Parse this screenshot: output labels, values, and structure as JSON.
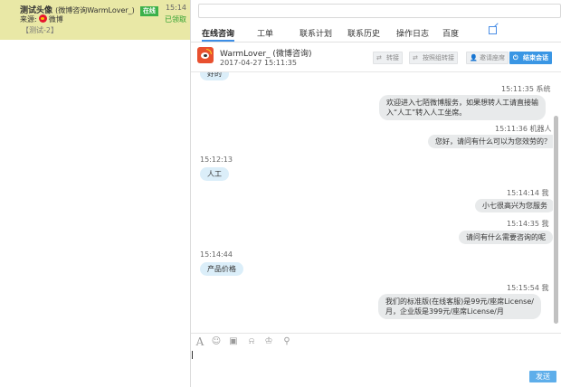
{
  "session": {
    "title": "测试头像",
    "nickname": "(微博咨询WarmLover_)",
    "status": "在线",
    "time": "15:14",
    "source_label": "来源:",
    "source_name": "微博",
    "claimed": "已领取",
    "tag": "【测试-2】"
  },
  "tabs": [
    "在线咨询",
    "工单",
    "联系计划",
    "联系历史",
    "操作日志",
    "百度"
  ],
  "visitor": {
    "name": "WarmLover_ (微博咨询)",
    "time": "2017-04-27 15:11:35"
  },
  "actions": {
    "transfer": "转接",
    "transfer_group": "按照组转接",
    "invite": "邀请座席",
    "end": "结束会话"
  },
  "messages": [
    {
      "role": "visitor",
      "text": "好的"
    },
    {
      "role": "system",
      "time": "15:11:35",
      "sender": "系统",
      "text_lines": [
        "欢迎进入七陌微博服务，如果想转人工请直接输",
        "入“人工”转入人工坐席。"
      ]
    },
    {
      "role": "robot",
      "time": "15:11:36",
      "sender": "机器人",
      "text_lines": [
        "您好，请问有什么可以为您效劳的？"
      ]
    },
    {
      "role": "visitor",
      "time": "15:12:13",
      "text": "人工"
    },
    {
      "role": "agent",
      "time": "15:14:14",
      "sender": "我",
      "text_lines": [
        "小七很高兴为您服务"
      ]
    },
    {
      "role": "agent",
      "time": "15:14:35",
      "sender": "我",
      "text_lines": [
        "请问有什么需要咨询的呢"
      ]
    },
    {
      "role": "visitor",
      "time": "15:14:44",
      "text": "产品价格"
    },
    {
      "role": "agent",
      "time": "15:15:54",
      "sender": "我",
      "text_lines": [
        "我们的标准版(在线客服)是99元/座席License/",
        "月，企业版是399元/座席License/月"
      ]
    }
  ],
  "toolbar_icons": [
    "font-icon",
    "emoji-icon",
    "image-icon",
    "bell-icon",
    "bot-icon",
    "user-search-icon"
  ],
  "send_label": "发送",
  "colors": {
    "session_bg": "#e9e8a6",
    "accent": "#3a96e4",
    "online": "#3bb14a",
    "visitor_bubble": "#dbeef9",
    "agent_bubble": "#e8eaeb"
  }
}
